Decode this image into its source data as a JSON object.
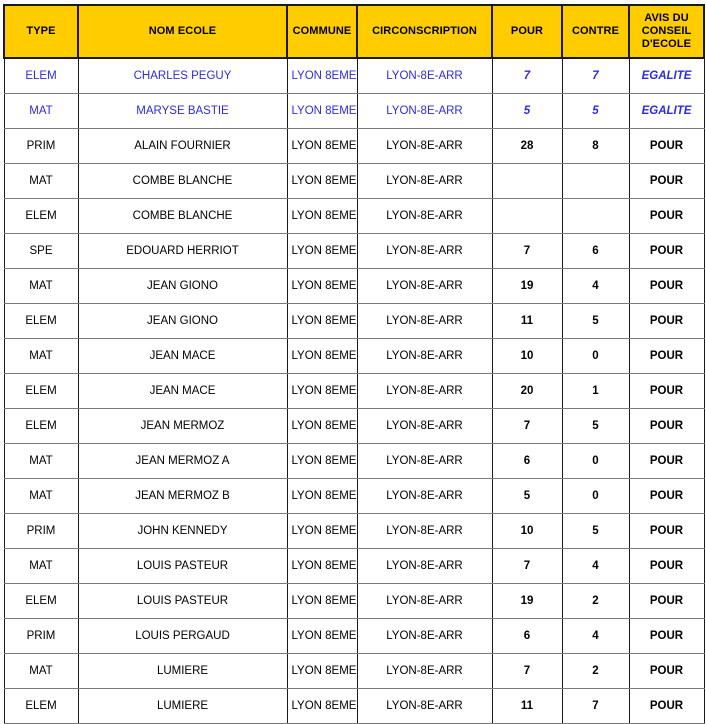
{
  "table": {
    "columns": [
      {
        "key": "type",
        "label": "TYPE"
      },
      {
        "key": "nom",
        "label": "NOM ECOLE"
      },
      {
        "key": "commune",
        "label": "COMMUNE"
      },
      {
        "key": "circ",
        "label": "CIRCONSCRIPTION"
      },
      {
        "key": "pour",
        "label": "POUR"
      },
      {
        "key": "contre",
        "label": "CONTRE"
      },
      {
        "key": "avis",
        "label": "AVIS DU CONSEIL D'ECOLE"
      }
    ],
    "header_avis_lines": [
      "AVIS DU",
      "CONSEIL",
      "D'ECOLE"
    ],
    "colors": {
      "header_background": "#FFCC00",
      "header_text": "#000000",
      "highlight_text": "#2B2BF0",
      "body_text": "#000000",
      "vertical_border": "#1A1A1A",
      "horizontal_border": "#7A7A7A",
      "page_background": "#FFFFFF"
    },
    "rows": [
      {
        "type": "ELEM",
        "nom": "CHARLES PEGUY",
        "commune": "LYON 8EME",
        "circ": "LYON-8E-ARR",
        "pour": "7",
        "contre": "7",
        "avis": "EGALITE",
        "highlight": true
      },
      {
        "type": "MAT",
        "nom": "MARYSE BASTIE",
        "commune": "LYON 8EME",
        "circ": "LYON-8E-ARR",
        "pour": "5",
        "contre": "5",
        "avis": "EGALITE",
        "highlight": true
      },
      {
        "type": "PRIM",
        "nom": "ALAIN FOURNIER",
        "commune": "LYON 8EME",
        "circ": "LYON-8E-ARR",
        "pour": "28",
        "contre": "8",
        "avis": "POUR",
        "highlight": false
      },
      {
        "type": "MAT",
        "nom": "COMBE BLANCHE",
        "commune": "LYON 8EME",
        "circ": "LYON-8E-ARR",
        "pour": "",
        "contre": "",
        "avis": "POUR",
        "highlight": false
      },
      {
        "type": "ELEM",
        "nom": "COMBE BLANCHE",
        "commune": "LYON 8EME",
        "circ": "LYON-8E-ARR",
        "pour": "",
        "contre": "",
        "avis": "POUR",
        "highlight": false
      },
      {
        "type": "SPE",
        "nom": "EDOUARD HERRIOT",
        "commune": "LYON 8EME",
        "circ": "LYON-8E-ARR",
        "pour": "7",
        "contre": "6",
        "avis": "POUR",
        "highlight": false
      },
      {
        "type": "MAT",
        "nom": "JEAN GIONO",
        "commune": "LYON 8EME",
        "circ": "LYON-8E-ARR",
        "pour": "19",
        "contre": "4",
        "avis": "POUR",
        "highlight": false
      },
      {
        "type": "ELEM",
        "nom": "JEAN GIONO",
        "commune": "LYON 8EME",
        "circ": "LYON-8E-ARR",
        "pour": "11",
        "contre": "5",
        "avis": "POUR",
        "highlight": false
      },
      {
        "type": "MAT",
        "nom": "JEAN MACE",
        "commune": "LYON 8EME",
        "circ": "LYON-8E-ARR",
        "pour": "10",
        "contre": "0",
        "avis": "POUR",
        "highlight": false
      },
      {
        "type": "ELEM",
        "nom": "JEAN MACE",
        "commune": "LYON 8EME",
        "circ": "LYON-8E-ARR",
        "pour": "20",
        "contre": "1",
        "avis": "POUR",
        "highlight": false
      },
      {
        "type": "ELEM",
        "nom": "JEAN MERMOZ",
        "commune": "LYON 8EME",
        "circ": "LYON-8E-ARR",
        "pour": "7",
        "contre": "5",
        "avis": "POUR",
        "highlight": false
      },
      {
        "type": "MAT",
        "nom": "JEAN MERMOZ A",
        "commune": "LYON 8EME",
        "circ": "LYON-8E-ARR",
        "pour": "6",
        "contre": "0",
        "avis": "POUR",
        "highlight": false
      },
      {
        "type": "MAT",
        "nom": "JEAN MERMOZ B",
        "commune": "LYON 8EME",
        "circ": "LYON-8E-ARR",
        "pour": "5",
        "contre": "0",
        "avis": "POUR",
        "highlight": false
      },
      {
        "type": "PRIM",
        "nom": "JOHN KENNEDY",
        "commune": "LYON 8EME",
        "circ": "LYON-8E-ARR",
        "pour": "10",
        "contre": "5",
        "avis": "POUR",
        "highlight": false
      },
      {
        "type": "MAT",
        "nom": "LOUIS PASTEUR",
        "commune": "LYON 8EME",
        "circ": "LYON-8E-ARR",
        "pour": "7",
        "contre": "4",
        "avis": "POUR",
        "highlight": false
      },
      {
        "type": "ELEM",
        "nom": "LOUIS PASTEUR",
        "commune": "LYON 8EME",
        "circ": "LYON-8E-ARR",
        "pour": "19",
        "contre": "2",
        "avis": "POUR",
        "highlight": false
      },
      {
        "type": "PRIM",
        "nom": "LOUIS PERGAUD",
        "commune": "LYON 8EME",
        "circ": "LYON-8E-ARR",
        "pour": "6",
        "contre": "4",
        "avis": "POUR",
        "highlight": false
      },
      {
        "type": "MAT",
        "nom": "LUMIERE",
        "commune": "LYON 8EME",
        "circ": "LYON-8E-ARR",
        "pour": "7",
        "contre": "2",
        "avis": "POUR",
        "highlight": false
      },
      {
        "type": "ELEM",
        "nom": "LUMIERE",
        "commune": "LYON 8EME",
        "circ": "LYON-8E-ARR",
        "pour": "11",
        "contre": "7",
        "avis": "POUR",
        "highlight": false
      }
    ]
  }
}
